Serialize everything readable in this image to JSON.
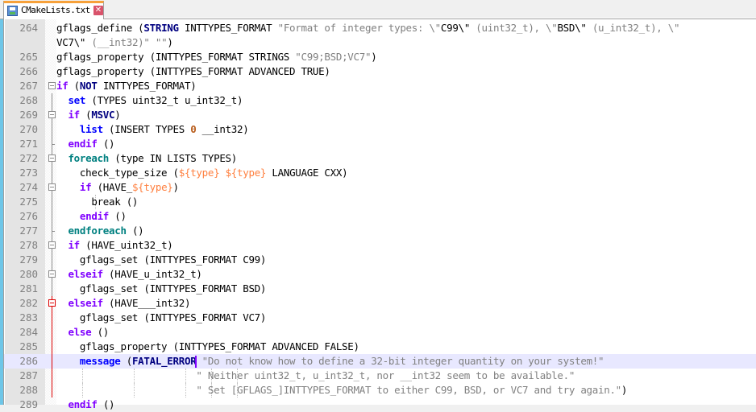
{
  "tab": {
    "icon": "saved-file-icon",
    "label": "CMakeLists.txt",
    "close_icon": "close-tab-icon"
  },
  "colors": {
    "tab_accent": "#f7a13a",
    "keyword_control": "#8000ff",
    "keyword_command": "#0000ff",
    "keyword_loop": "#008080",
    "string": "#808080",
    "variable": "#ff8040",
    "current_line": "#e8e8ff",
    "fold_active": "#dd0000"
  },
  "editor": {
    "current_line": 286,
    "lines": [
      {
        "num": "264",
        "tokens": [
          [
            "",
            "gflags_define ("
          ],
          [
            "arg",
            "STRING"
          ],
          [
            "",
            " INTTYPES_FORMAT "
          ],
          [
            "str",
            "\"Format of integer types: \\\""
          ],
          [
            "",
            "C99\\\""
          ],
          [
            "str",
            " (uint32_t), \\\""
          ],
          [
            "",
            "BSD\\\""
          ],
          [
            "str",
            " (u_int32_t), \\\""
          ]
        ]
      },
      {
        "num": "",
        "tokens": [
          [
            "",
            "VC7\\\""
          ],
          [
            "str",
            " (__int32)\" \"\""
          ],
          [
            "",
            ")"
          ]
        ]
      },
      {
        "num": "265",
        "tokens": [
          [
            "",
            "gflags_property (INTTYPES_FORMAT STRINGS "
          ],
          [
            "str",
            "\"C99;BSD;VC7\""
          ],
          [
            "",
            ")"
          ]
        ]
      },
      {
        "num": "266",
        "tokens": [
          [
            "",
            "gflags_property (INTTYPES_FORMAT ADVANCED TRUE)"
          ]
        ]
      },
      {
        "num": "267",
        "tokens": [
          [
            "kwp",
            "if"
          ],
          [
            "",
            " ("
          ],
          [
            "arg",
            "NOT"
          ],
          [
            "",
            " INTTYPES_FORMAT)"
          ]
        ]
      },
      {
        "num": "268",
        "tokens": [
          [
            "",
            "  "
          ],
          [
            "kwb",
            "set"
          ],
          [
            "",
            " (TYPES uint32_t u_int32_t)"
          ]
        ]
      },
      {
        "num": "269",
        "tokens": [
          [
            "",
            "  "
          ],
          [
            "kwp",
            "if"
          ],
          [
            "",
            " ("
          ],
          [
            "arg",
            "MSVC"
          ],
          [
            "",
            ")"
          ]
        ]
      },
      {
        "num": "270",
        "tokens": [
          [
            "",
            "    "
          ],
          [
            "kwb",
            "list"
          ],
          [
            "",
            " (INSERT TYPES "
          ],
          [
            "num",
            "0"
          ],
          [
            "",
            " __int32)"
          ]
        ]
      },
      {
        "num": "271",
        "tokens": [
          [
            "",
            "  "
          ],
          [
            "kwp",
            "endif"
          ],
          [
            "",
            " ()"
          ]
        ]
      },
      {
        "num": "272",
        "tokens": [
          [
            "",
            "  "
          ],
          [
            "kwt",
            "foreach"
          ],
          [
            "",
            " (type IN LISTS TYPES)"
          ]
        ]
      },
      {
        "num": "273",
        "tokens": [
          [
            "",
            "    check_type_size ("
          ],
          [
            "var",
            "${type}"
          ],
          [
            "",
            " "
          ],
          [
            "var",
            "${type}"
          ],
          [
            "",
            " LANGUAGE CXX)"
          ]
        ]
      },
      {
        "num": "274",
        "tokens": [
          [
            "",
            "    "
          ],
          [
            "kwp",
            "if"
          ],
          [
            "",
            " (HAVE_"
          ],
          [
            "var",
            "${type}"
          ],
          [
            "",
            ")"
          ]
        ]
      },
      {
        "num": "275",
        "tokens": [
          [
            "",
            "      break ()"
          ]
        ]
      },
      {
        "num": "276",
        "tokens": [
          [
            "",
            "    "
          ],
          [
            "kwp",
            "endif"
          ],
          [
            "",
            " ()"
          ]
        ]
      },
      {
        "num": "277",
        "tokens": [
          [
            "",
            "  "
          ],
          [
            "kwt",
            "endforeach"
          ],
          [
            "",
            " ()"
          ]
        ]
      },
      {
        "num": "278",
        "tokens": [
          [
            "",
            "  "
          ],
          [
            "kwp",
            "if"
          ],
          [
            "",
            " (HAVE_uint32_t)"
          ]
        ]
      },
      {
        "num": "279",
        "tokens": [
          [
            "",
            "    gflags_set (INTTYPES_FORMAT C99)"
          ]
        ]
      },
      {
        "num": "280",
        "tokens": [
          [
            "",
            "  "
          ],
          [
            "kwp",
            "elseif"
          ],
          [
            "",
            " (HAVE_u_int32_t)"
          ]
        ]
      },
      {
        "num": "281",
        "tokens": [
          [
            "",
            "    gflags_set (INTTYPES_FORMAT BSD)"
          ]
        ]
      },
      {
        "num": "282",
        "tokens": [
          [
            "",
            "  "
          ],
          [
            "kwp",
            "elseif"
          ],
          [
            "",
            " (HAVE___int32)"
          ]
        ]
      },
      {
        "num": "283",
        "tokens": [
          [
            "",
            "    gflags_set (INTTYPES_FORMAT VC7)"
          ]
        ]
      },
      {
        "num": "284",
        "tokens": [
          [
            "",
            "  "
          ],
          [
            "kwp",
            "else"
          ],
          [
            "",
            " ()"
          ]
        ]
      },
      {
        "num": "285",
        "tokens": [
          [
            "",
            "    gflags_property (INTTYPES_FORMAT ADVANCED FALSE)"
          ]
        ]
      },
      {
        "num": "286",
        "tokens": [
          [
            "",
            "    "
          ],
          [
            "kwb",
            "message"
          ],
          [
            "",
            " ("
          ],
          [
            "arg",
            "FATAL_ERROR"
          ],
          [
            "caret",
            ""
          ],
          [
            "",
            " "
          ],
          [
            "str",
            "\"Do not know how to define a 32-bit integer quantity on your system!\""
          ]
        ]
      },
      {
        "num": "287",
        "tokens": [
          [
            "",
            "                        "
          ],
          [
            "str",
            "\" Neither uint32_t, u_int32_t, nor __int32 seem to be available.\""
          ]
        ]
      },
      {
        "num": "288",
        "tokens": [
          [
            "",
            "                        "
          ],
          [
            "str",
            "\" Set [GFLAGS_]INTTYPES_FORMAT to either C99, BSD, or VC7 and try again.\""
          ],
          [
            "",
            ")"
          ]
        ]
      },
      {
        "num": "289",
        "tokens": [
          [
            "",
            "  "
          ],
          [
            "kwp",
            "endif"
          ],
          [
            "",
            " ()"
          ]
        ]
      }
    ]
  }
}
